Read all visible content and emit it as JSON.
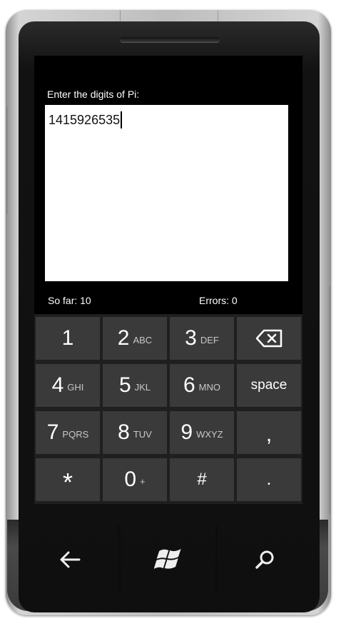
{
  "app": {
    "prompt_label": "Enter the digits of Pi:",
    "digits_value": "1415926535",
    "so_far_label": "So far: 10",
    "errors_label": "Errors: 0"
  },
  "keypad": {
    "rows": [
      [
        {
          "main": "1",
          "sub": ""
        },
        {
          "main": "2",
          "sub": "ABC"
        },
        {
          "main": "3",
          "sub": "DEF"
        },
        {
          "main": "",
          "sub": "",
          "icon": "backspace-icon"
        }
      ],
      [
        {
          "main": "4",
          "sub": "GHI"
        },
        {
          "main": "5",
          "sub": "JKL"
        },
        {
          "main": "6",
          "sub": "MNO"
        },
        {
          "main": "space",
          "sub": ""
        }
      ],
      [
        {
          "main": "7",
          "sub": "PQRS"
        },
        {
          "main": "8",
          "sub": "TUV"
        },
        {
          "main": "9",
          "sub": "WXYZ"
        },
        {
          "main": ",",
          "sub": ""
        }
      ],
      [
        {
          "main": "*",
          "sub": ""
        },
        {
          "main": "0",
          "sub": "+"
        },
        {
          "main": "#",
          "sub": ""
        },
        {
          "main": ".",
          "sub": ""
        }
      ]
    ]
  },
  "hardware_buttons": [
    "back-arrow-icon",
    "windows-start-icon",
    "search-icon"
  ],
  "colors": {
    "screen_bg": "#000000",
    "key_bg": "#3a3a3a",
    "keypad_bg": "#1f1f1f",
    "text": "#ffffff"
  }
}
